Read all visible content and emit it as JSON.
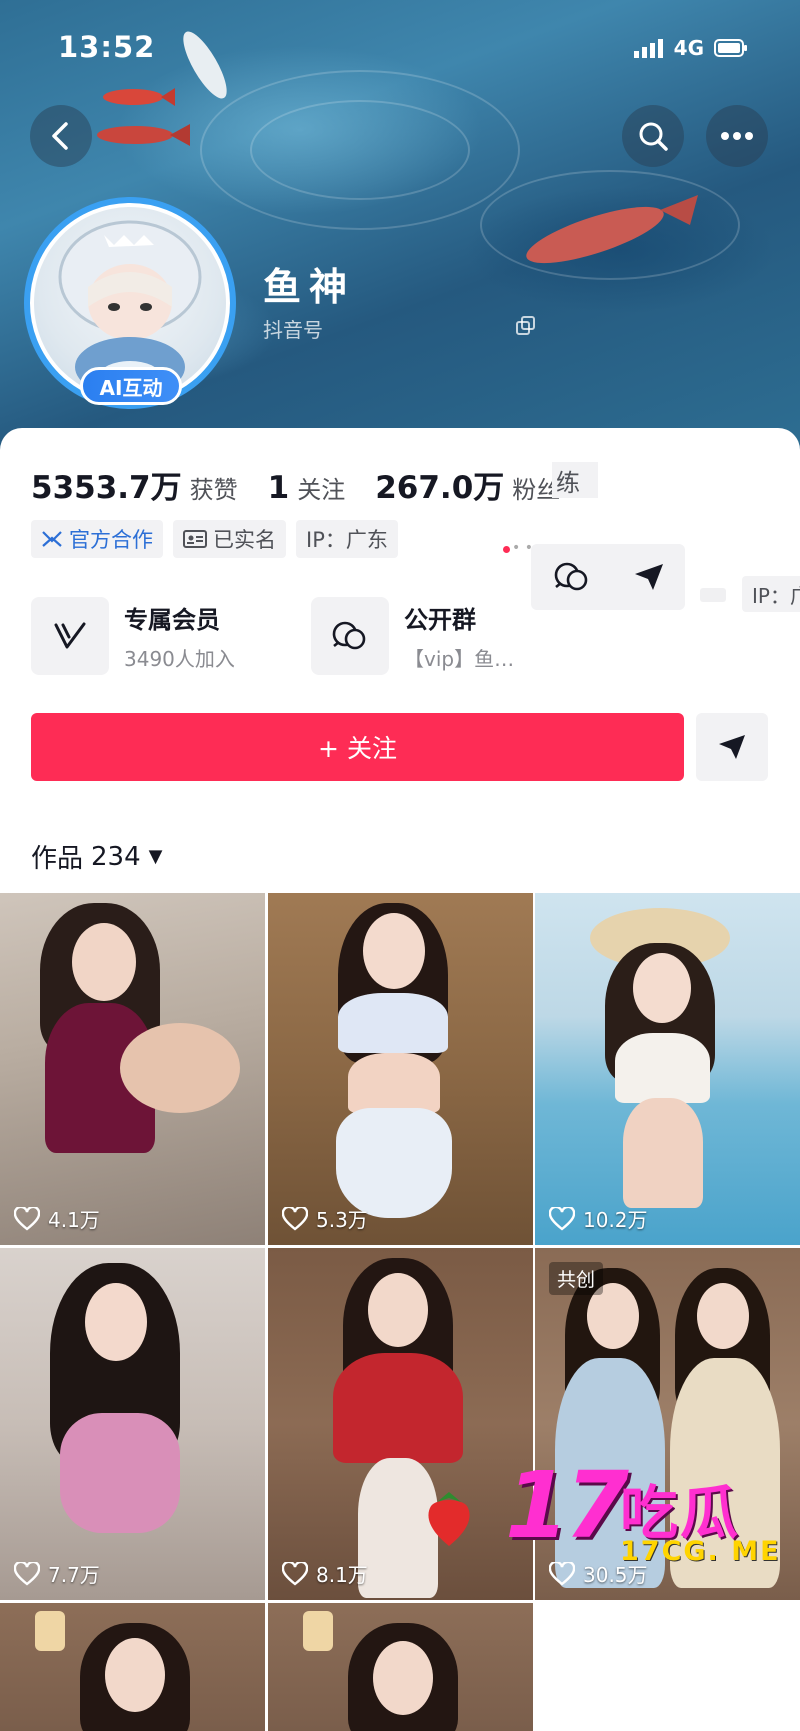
{
  "status_bar": {
    "time": "13:52",
    "network": "4G"
  },
  "header": {
    "nickname": "鱼神",
    "douyin_id_label": "抖音号",
    "ai_badge": "AI互动"
  },
  "stats": {
    "likes_value": "5353.7万",
    "likes_label": "获赞",
    "following_value": "1",
    "following_label": "关注",
    "followers_value": "267.0万",
    "followers_label": "粉丝",
    "cut_fragment": "练"
  },
  "tags": {
    "official": "官方合作",
    "verified": "已实名",
    "ip": "IP：广东",
    "ip_fragment": "IP：广"
  },
  "features": {
    "membership_title": "专属会员",
    "membership_sub": "3490人加入",
    "group_title": "公开群",
    "group_sub": "【vip】鱼…"
  },
  "actions": {
    "follow_label": "+ 关注"
  },
  "works": {
    "label": "作品",
    "count": "234"
  },
  "videos": [
    {
      "likes": "4.1万"
    },
    {
      "likes": "5.3万"
    },
    {
      "likes": "10.2万"
    },
    {
      "likes": "7.7万"
    },
    {
      "likes": "8.1万"
    },
    {
      "likes": "30.5万",
      "badge": "共创"
    }
  ],
  "watermark": {
    "big": "17",
    "cn": "吃瓜",
    "url": "17CG. ME"
  },
  "colors": {
    "accent": "#fe2c55",
    "official_blue": "#2c6fd6",
    "avatar_ring": "#3aa0f2"
  }
}
